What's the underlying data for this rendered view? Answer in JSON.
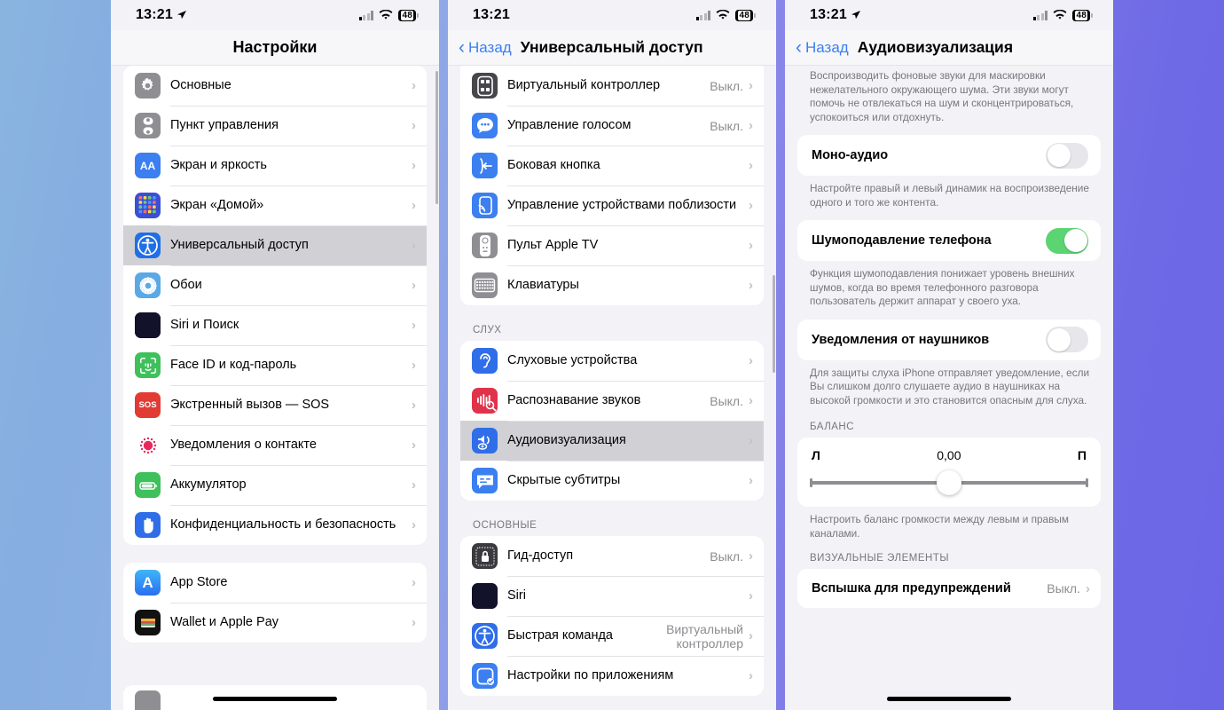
{
  "statusbar": {
    "time": "13:21",
    "battery": "48"
  },
  "panel1": {
    "title": "Настройки",
    "groups": [
      {
        "items": [
          {
            "label": "Основные",
            "icon": "gear-icon",
            "icon_bg": "#8e8e93",
            "glyph": "⚙"
          },
          {
            "label": "Пункт управления",
            "icon": "control-center-icon",
            "icon_bg": "#8e8e93",
            "glyph": "◉"
          },
          {
            "label": "Экран и яркость",
            "icon": "display-brightness-icon",
            "icon_bg": "#3b7ff0",
            "glyph": "AA"
          },
          {
            "label": "Экран «Домой»",
            "icon": "home-screen-icon",
            "icon_bg": "#3b4fd6",
            "glyph": "▦"
          },
          {
            "label": "Универсальный доступ",
            "icon": "accessibility-icon",
            "icon_bg": "#1f6fe8",
            "glyph": "◉",
            "selected": true
          },
          {
            "label": "Обои",
            "icon": "wallpaper-icon",
            "icon_bg": "#5aa9e6",
            "glyph": "❋"
          },
          {
            "label": "Siri и Поиск",
            "icon": "siri-icon",
            "icon_bg": "#1a1a2e",
            "glyph": "◍"
          },
          {
            "label": "Face ID и код-пароль",
            "icon": "face-id-icon",
            "icon_bg": "#3ec05a",
            "glyph": "☺"
          },
          {
            "label": "Экстренный вызов — SOS",
            "icon": "sos-icon",
            "icon_bg": "#e23b35",
            "glyph": "SOS"
          },
          {
            "label": "Уведомления о контакте",
            "icon": "contact-alert-icon",
            "icon_bg": "#ffffff",
            "glyph": "✺"
          },
          {
            "label": "Аккумулятор",
            "icon": "battery-icon",
            "icon_bg": "#3ec05a",
            "glyph": "▭"
          },
          {
            "label": "Конфиденциальность и безопасность",
            "icon": "privacy-hand-icon",
            "icon_bg": "#2f6ee8",
            "glyph": "✋"
          }
        ]
      },
      {
        "items": [
          {
            "label": "App Store",
            "icon": "app-store-icon",
            "icon_bg": "#2b8ff5",
            "glyph": "A"
          },
          {
            "label": "Wallet и Apple Pay",
            "icon": "wallet-icon",
            "icon_bg": "#111111",
            "glyph": "▤"
          }
        ]
      }
    ]
  },
  "panel2": {
    "back": "Назад",
    "title": "Универсальный доступ",
    "groups": [
      {
        "header": "",
        "items": [
          {
            "label": "Виртуальный контроллер",
            "value": "Выкл.",
            "icon": "virtual-controller-icon",
            "icon_bg": "#46464b",
            "glyph": "⠿"
          },
          {
            "label": "Управление голосом",
            "value": "Выкл.",
            "icon": "voice-control-icon",
            "icon_bg": "#3b7ff0",
            "glyph": "☻"
          },
          {
            "label": "Боковая кнопка",
            "value": "",
            "icon": "side-button-icon",
            "icon_bg": "#3b7ff0",
            "glyph": "⇤"
          },
          {
            "label": "Управление устройствами поблизости",
            "value": "",
            "icon": "nearby-devices-icon",
            "icon_bg": "#3b7ff0",
            "glyph": "▯"
          },
          {
            "label": "Пульт Apple TV",
            "value": "",
            "icon": "apple-tv-remote-icon",
            "icon_bg": "#8e8e93",
            "glyph": "▮"
          },
          {
            "label": "Клавиатуры",
            "value": "",
            "icon": "keyboard-icon",
            "icon_bg": "#8e8e93",
            "glyph": "⌨"
          }
        ]
      },
      {
        "header": "СЛУХ",
        "items": [
          {
            "label": "Слуховые устройства",
            "value": "",
            "icon": "hearing-devices-icon",
            "icon_bg": "#2f6ee8",
            "glyph": "◖"
          },
          {
            "label": "Распознавание звуков",
            "value": "Выкл.",
            "icon": "sound-recognition-icon",
            "icon_bg": "#e0334a",
            "glyph": "⫴"
          },
          {
            "label": "Аудиовизуализация",
            "value": "",
            "icon": "audio-visual-icon",
            "icon_bg": "#2f6ee8",
            "glyph": "◉",
            "selected": true
          },
          {
            "label": "Скрытые субтитры",
            "value": "",
            "icon": "closed-captions-icon",
            "icon_bg": "#3b7ff0",
            "glyph": "▣"
          }
        ]
      },
      {
        "header": "ОСНОВНЫЕ",
        "items": [
          {
            "label": "Гид-доступ",
            "value": "Выкл.",
            "icon": "guided-access-icon",
            "icon_bg": "#3a3a3f",
            "glyph": "🔒"
          },
          {
            "label": "Siri",
            "value": "",
            "icon": "siri-icon",
            "icon_bg": "#1a1a2e",
            "glyph": "◍"
          },
          {
            "label": "Быстрая команда",
            "value": "Виртуальный контроллер",
            "icon": "accessibility-shortcut-icon",
            "icon_bg": "#2f6ee8",
            "glyph": "◉"
          },
          {
            "label": "Настройки по приложениям",
            "value": "",
            "icon": "per-app-settings-icon",
            "icon_bg": "#3b7ff0",
            "glyph": "▢"
          }
        ]
      }
    ]
  },
  "panel3": {
    "back": "Назад",
    "title": "Аудиовизуализация",
    "intro": "Воспроизводить фоновые звуки для маскировки нежелательного окружающего шума. Эти звуки могут помочь не отвлекаться на шум и сконцентрироваться, успокоиться или отдохнуть.",
    "mono_audio": {
      "label": "Моно-аудио",
      "state": "off"
    },
    "mono_note": "Настройте правый и левый динамик на воспроизведение одного и того же контента.",
    "phone_noise": {
      "label": "Шумоподавление телефона",
      "state": "on"
    },
    "phone_noise_note": "Функция шумоподавления понижает уровень внешних шумов, когда во время телефонного разговора пользователь держит аппарат у своего уха.",
    "headphone_notif": {
      "label": "Уведомления от наушников",
      "state": "off"
    },
    "headphone_note": "Для защиты слуха iPhone отправляет уведомление, если Вы слишком долго слушаете аудио в наушниках на высокой громкости и это становится опасным для слуха.",
    "balance_header": "БАЛАНС",
    "balance": {
      "left": "Л",
      "value": "0,00",
      "right": "П",
      "position_pct": 50
    },
    "balance_note": "Настроить баланс громкости между левым и правым каналами.",
    "visual_header": "ВИЗУАЛЬНЫЕ ЭЛЕМЕНТЫ",
    "flash_alerts": {
      "label": "Вспышка для предупреждений",
      "value": "Выкл."
    }
  }
}
